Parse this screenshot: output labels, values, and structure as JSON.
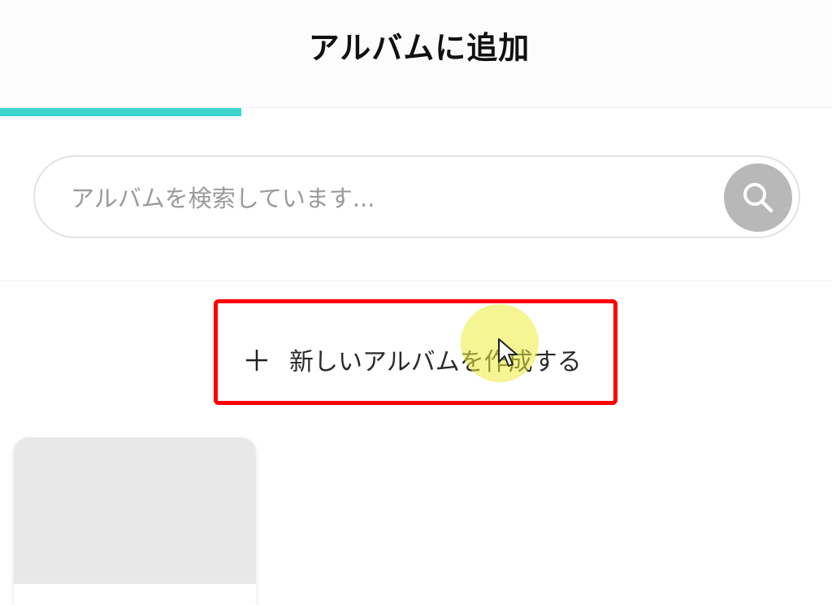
{
  "header": {
    "title": "アルバムに追加"
  },
  "progress": {
    "fraction": 0.29,
    "color": "#3dd6cc"
  },
  "search": {
    "placeholder": "アルバムを検索しています...",
    "value": "",
    "icon": "search-icon"
  },
  "create_album": {
    "icon": "plus-icon",
    "label": "新しいアルバムを作成する",
    "highlight_color": "#ff0000"
  },
  "albums": [
    {
      "thumbnail": "empty"
    }
  ]
}
